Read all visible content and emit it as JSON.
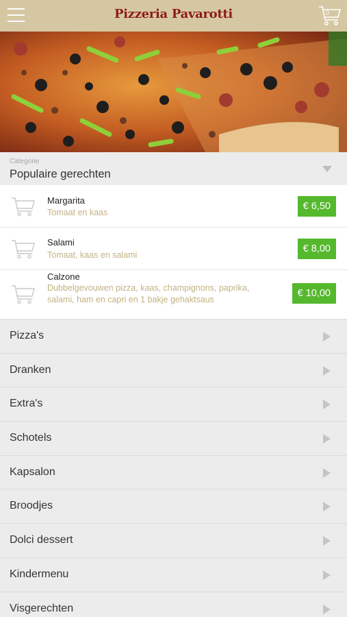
{
  "header": {
    "brand": "Pizzeria Pavarotti",
    "cart_count": "0",
    "menu_icon": "hamburger-icon",
    "cart_icon": "cart-icon"
  },
  "hero": {
    "image": "pizza-photo"
  },
  "category_select": {
    "label": "Categorie",
    "value": "Populaire gerechten"
  },
  "dishes": [
    {
      "name": "Margarita",
      "description": "Tomaat en kaas",
      "price": "€ 6,50"
    },
    {
      "name": "Salami",
      "description": "Tomaat, kaas en salami",
      "price": "€ 8,00"
    },
    {
      "name": "Calzone",
      "description": "Dubbelgevouwen pizza, kaas, champignons, paprika, salami, ham en capri en 1 bakje gehaktsaus",
      "price": "€ 10,00"
    }
  ],
  "categories": [
    {
      "label": "Pizza's"
    },
    {
      "label": "Dranken"
    },
    {
      "label": "Extra's"
    },
    {
      "label": "Schotels"
    },
    {
      "label": "Kapsalon"
    },
    {
      "label": "Broodjes"
    },
    {
      "label": "Dolci dessert"
    },
    {
      "label": "Kindermenu"
    },
    {
      "label": "Visgerechten"
    }
  ],
  "colors": {
    "topbar": "#d6c7a3",
    "brand": "#8e1a1a",
    "price_badge": "#55b82d",
    "description": "#c2b283"
  }
}
